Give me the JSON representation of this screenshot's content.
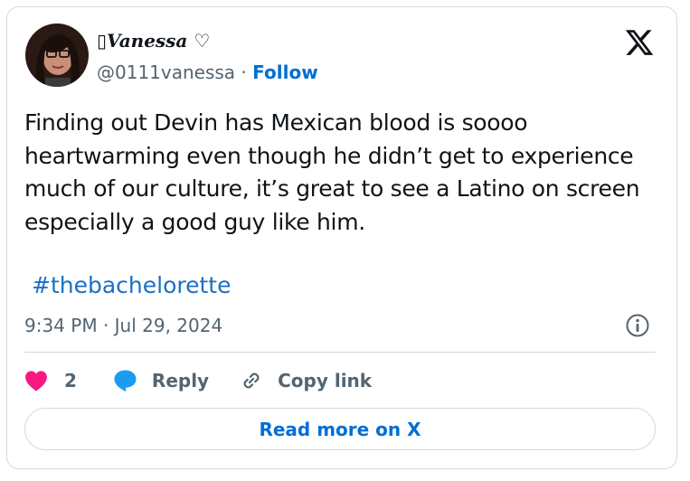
{
  "author": {
    "display_name": "▯Vanessa ♡",
    "handle": "@0111vanessa",
    "separator": " · ",
    "follow_label": "Follow"
  },
  "tweet": {
    "text": "Finding out Devin has Mexican blood is soooo heartwarming even though he didn’t get to experience much of our culture, it’s great to see a Latino on screen especially a good guy like him.",
    "hashtag": "#thebachelorette",
    "timestamp": "9:34 PM · Jul 29, 2024"
  },
  "actions": {
    "like_count": "2",
    "reply_label": "Reply",
    "copy_link_label": "Copy link"
  },
  "read_more_label": "Read more on X",
  "icons": [
    "x-logo-icon",
    "info-icon",
    "heart-icon",
    "reply-bubble-icon",
    "link-icon"
  ],
  "colors": {
    "link_blue": "#006fd6",
    "heart_pink": "#f91880",
    "reply_blue": "#1d9bf0",
    "text": "#0f1419",
    "muted": "#536471"
  }
}
